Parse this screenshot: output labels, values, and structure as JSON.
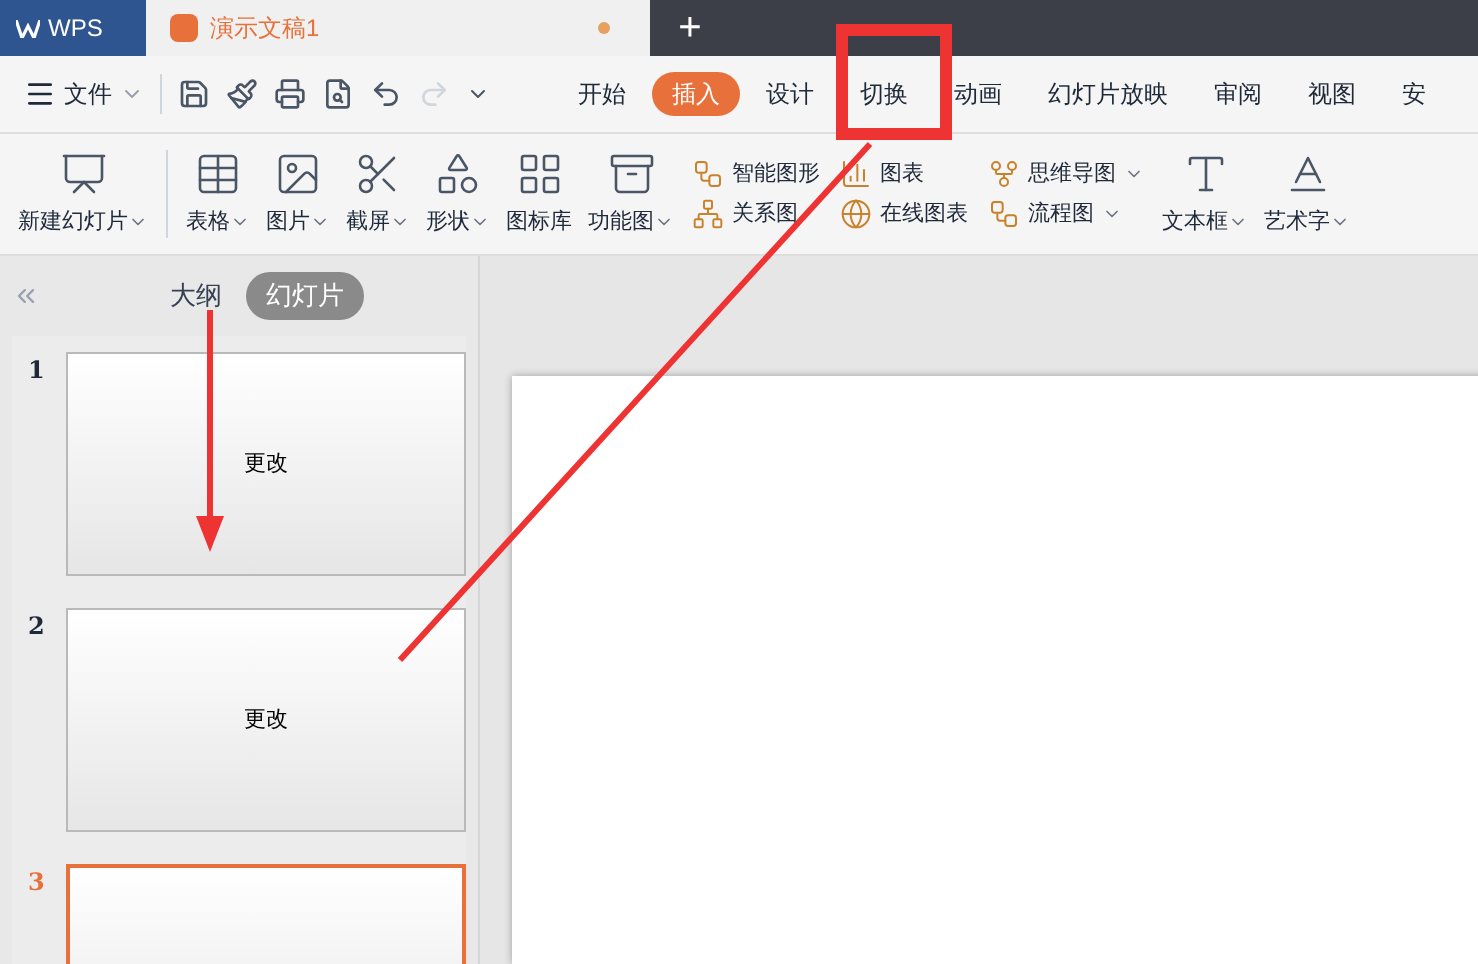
{
  "title_bar": {
    "app_tab": "WPS",
    "document_tab": {
      "title": "演示文稿1",
      "modified": true
    },
    "new_tab": "+"
  },
  "menu": {
    "file": "文件",
    "tabs": [
      {
        "label": "开始",
        "selected": false
      },
      {
        "label": "插入",
        "selected": true
      },
      {
        "label": "设计",
        "selected": false
      },
      {
        "label": "切换",
        "selected": false
      },
      {
        "label": "动画",
        "selected": false
      },
      {
        "label": "幻灯片放映",
        "selected": false
      },
      {
        "label": "审阅",
        "selected": false
      },
      {
        "label": "视图",
        "selected": false
      },
      {
        "label": "安",
        "selected": false
      }
    ]
  },
  "ribbon": {
    "large_left": [
      {
        "label": "新建幻灯片",
        "menu": true
      },
      {
        "label": "表格",
        "menu": true
      },
      {
        "label": "图片",
        "menu": true
      },
      {
        "label": "截屏",
        "menu": true
      },
      {
        "label": "形状",
        "menu": true
      },
      {
        "label": "图标库",
        "menu": false
      },
      {
        "label": "功能图",
        "menu": true
      }
    ],
    "small_columns": [
      [
        {
          "label": "智能图形",
          "menu": false
        },
        {
          "label": "关系图",
          "menu": false
        }
      ],
      [
        {
          "label": "图表",
          "menu": false
        },
        {
          "label": "在线图表",
          "menu": false
        }
      ],
      [
        {
          "label": "思维导图",
          "menu": true
        },
        {
          "label": "流程图",
          "menu": true
        }
      ]
    ],
    "large_right": [
      {
        "label": "文本框",
        "menu": true
      },
      {
        "label": "艺术字",
        "menu": true
      }
    ]
  },
  "panel": {
    "tabs": [
      {
        "label": "大纲",
        "selected": false
      },
      {
        "label": "幻灯片",
        "selected": true
      }
    ],
    "slides": [
      {
        "number": "1",
        "title": "更改",
        "selected": false
      },
      {
        "number": "2",
        "title": "更改",
        "selected": false
      },
      {
        "number": "3",
        "selected": true
      }
    ]
  }
}
